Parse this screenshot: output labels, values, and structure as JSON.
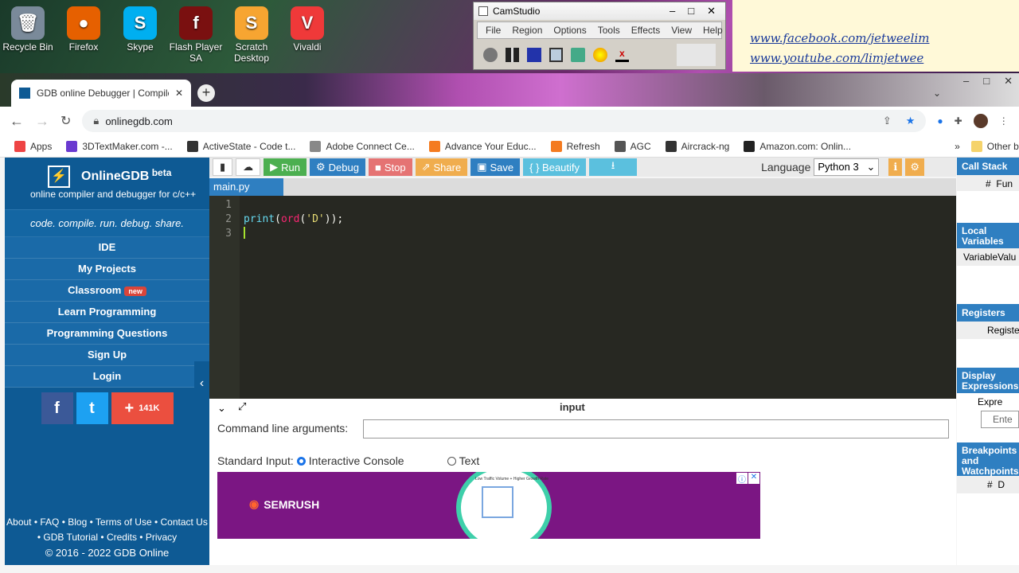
{
  "desktop": {
    "icons": [
      {
        "label": "Recycle Bin",
        "color": "#7a8a9a",
        "glyph": "🗑"
      },
      {
        "label": "Firefox",
        "color": "#e66000",
        "glyph": "●"
      },
      {
        "label": "Skype",
        "color": "#00aff0",
        "glyph": "S"
      },
      {
        "label": "Flash Player SA",
        "color": "#7a1010",
        "glyph": "f"
      },
      {
        "label": "Scratch Desktop",
        "color": "#f7a531",
        "glyph": "S"
      },
      {
        "label": "Vivaldi",
        "color": "#ef3939",
        "glyph": "V"
      }
    ]
  },
  "camstudio": {
    "title": "CamStudio",
    "menu": [
      "File",
      "Region",
      "Options",
      "Tools",
      "Effects",
      "View",
      "Help"
    ]
  },
  "note": {
    "links": [
      "www.facebook.com/jetweelim",
      "www.youtube.com/limjetwee"
    ]
  },
  "browser": {
    "tab_title": "GDB online Debugger | Compile",
    "url": "onlinegdb.com",
    "bookmarks": [
      {
        "label": "Apps",
        "color": "#e44"
      },
      {
        "label": "3DTextMaker.com -...",
        "color": "#6a3ad0"
      },
      {
        "label": "ActiveState - Code t...",
        "color": "#333"
      },
      {
        "label": "Adobe Connect Ce...",
        "color": "#888"
      },
      {
        "label": "Advance Your Educ...",
        "color": "#f47b20"
      },
      {
        "label": "Refresh",
        "color": "#f47b20"
      },
      {
        "label": "AGC",
        "color": "#555"
      },
      {
        "label": "Aircrack-ng",
        "color": "#333"
      },
      {
        "label": "Amazon.com: Onlin...",
        "color": "#222"
      }
    ],
    "other_bookmarks": "Other bookmarks"
  },
  "sidebar": {
    "brand": "OnlineGDB",
    "beta": "beta",
    "subtitle": "online compiler and debugger for c/c++",
    "tagline": "code. compile. run. debug. share.",
    "nav": [
      "IDE",
      "My Projects",
      "Classroom",
      "Learn Programming",
      "Programming Questions",
      "Sign Up",
      "Login"
    ],
    "new_badge": "new",
    "share_count": "141K",
    "footer_links_1": "About • FAQ • Blog • Terms of Use • Contact Us",
    "footer_links_2": "• GDB Tutorial • Credits • Privacy",
    "copyright": "© 2016 - 2022 GDB Online"
  },
  "toolbar": {
    "run": "Run",
    "debug": "Debug",
    "stop": "Stop",
    "share": "Share",
    "save": "Save",
    "beautify": "{ } Beautify",
    "language_label": "Language",
    "language": "Python 3"
  },
  "editor": {
    "filename": "main.py",
    "line_numbers": [
      "1",
      "2",
      "3"
    ]
  },
  "input": {
    "title": "input",
    "cmd_label": "Command line arguments:",
    "stdin_label": "Standard Input:",
    "interactive": "Interactive Console",
    "text": "Text",
    "ad_brand": "SEMRUSH",
    "ad_caption": "Low Traffic Volume + Higher Growth Rate"
  },
  "right": {
    "call_stack": "Call Stack",
    "hash": "#",
    "func": "Fun",
    "local": "Local Variables",
    "variable": "VariableValu",
    "registers": "Registers",
    "register": "Registe",
    "display": "Display Expressions",
    "expr": "Expre",
    "enter": "Ente",
    "breakpoints": "Breakpoints and Watchpoints",
    "d": "D"
  }
}
